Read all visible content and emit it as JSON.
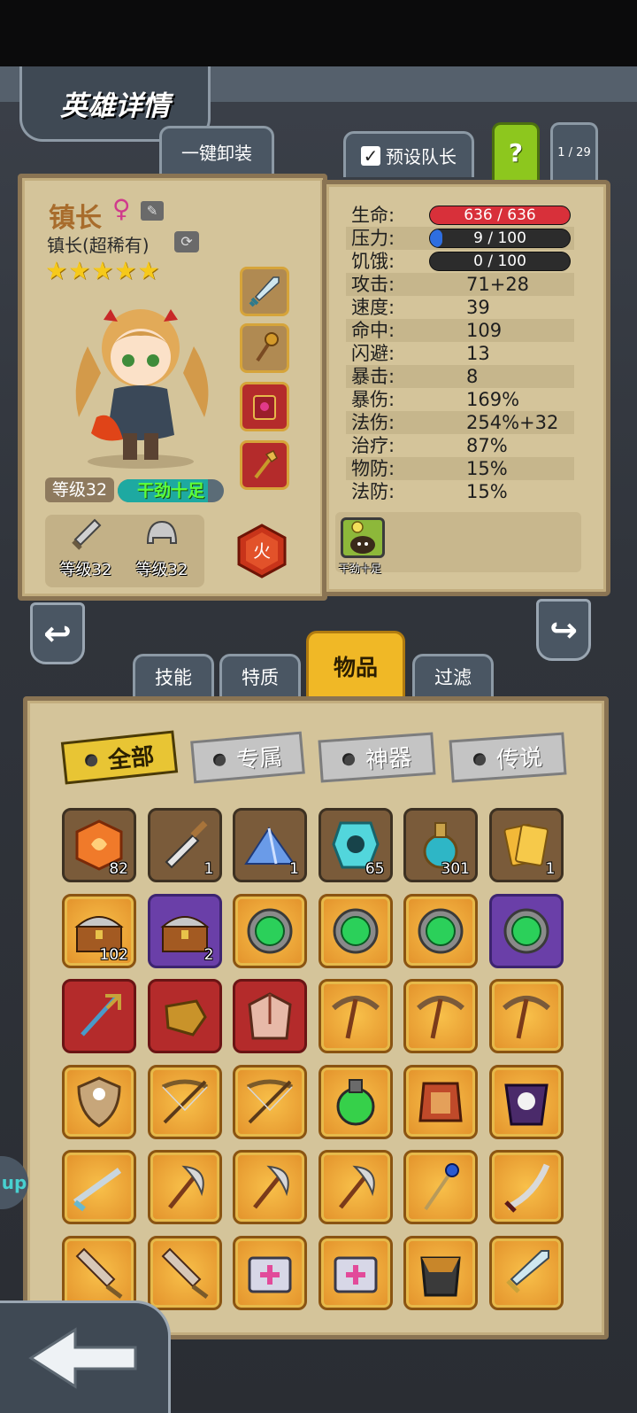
{
  "screen": {
    "title": "英雄详情",
    "unequip_all_label": "一键卸装",
    "preset_leader_label": "预设队长",
    "preset_leader_checked": true,
    "help_label": "?",
    "page_indicator": "1 / 29"
  },
  "hero": {
    "name": "镇长",
    "gender_symbol": "♀",
    "class_label": "镇长(超稀有)",
    "stars": "★★★★★",
    "star_count": 5,
    "level_label": "等级32",
    "mood_label": "干劲十足",
    "mood_fill": 0.85,
    "weapon_level": "等级32",
    "armor_level": "等级32",
    "element_label": "火",
    "equipment_slots": [
      "sword-icon",
      "staff-icon",
      "tome-icon",
      "scepter-icon"
    ]
  },
  "stats": {
    "hp": {
      "label": "生命:",
      "value": "636 / 636",
      "fill": 1.0,
      "color": "#d8303a"
    },
    "stress": {
      "label": "压力:",
      "value": "9 / 100",
      "fill": 0.09,
      "color": "#2e6ee0"
    },
    "hunger": {
      "label": "饥饿:",
      "value": "0 / 100",
      "fill": 0.0,
      "color": "#c08a2a"
    },
    "rows": [
      {
        "label": "攻击:",
        "value": "71+28"
      },
      {
        "label": "速度:",
        "value": "39"
      },
      {
        "label": "命中:",
        "value": "109"
      },
      {
        "label": "闪避:",
        "value": "13"
      },
      {
        "label": "暴击:",
        "value": "8"
      },
      {
        "label": "暴伤:",
        "value": "169%"
      },
      {
        "label": "法伤:",
        "value": "254%+32"
      },
      {
        "label": "治疗:",
        "value": "87%"
      },
      {
        "label": "物防:",
        "value": "15%"
      },
      {
        "label": "法防:",
        "value": "15%"
      }
    ],
    "trait_label": "干劲十足"
  },
  "category_tabs": [
    "技能",
    "特质",
    "物品",
    "过滤"
  ],
  "active_category": "物品",
  "filters": [
    "全部",
    "专属",
    "神器",
    "传说"
  ],
  "active_filter": "全部",
  "side_tag_label": "up",
  "inventory": [
    [
      {
        "icon": "orange-gem-icon",
        "qty": "82",
        "frame": "brown"
      },
      {
        "icon": "knife-icon",
        "qty": "1",
        "frame": "brown"
      },
      {
        "icon": "crystal-pile-icon",
        "qty": "1",
        "frame": "brown"
      },
      {
        "icon": "rune-stone-icon",
        "qty": "65",
        "frame": "brown"
      },
      {
        "icon": "potion-flask-icon",
        "qty": "301",
        "frame": "brown"
      },
      {
        "icon": "ticket-icon",
        "qty": "1",
        "frame": "brown"
      }
    ],
    [
      {
        "icon": "treasure-chest-icon",
        "qty": "102",
        "frame": "orange"
      },
      {
        "icon": "treasure-chest-icon",
        "qty": "2",
        "frame": "purple"
      },
      {
        "icon": "green-orb-icon",
        "qty": "",
        "frame": "orange"
      },
      {
        "icon": "green-orb-icon",
        "qty": "",
        "frame": "orange"
      },
      {
        "icon": "green-orb-icon",
        "qty": "",
        "frame": "orange"
      },
      {
        "icon": "green-orb-icon",
        "qty": "",
        "frame": "purple"
      }
    ],
    [
      {
        "icon": "cross-staff-icon",
        "qty": "",
        "frame": "red"
      },
      {
        "icon": "gauntlet-icon",
        "qty": "",
        "frame": "red"
      },
      {
        "icon": "cloak-icon",
        "qty": "",
        "frame": "red"
      },
      {
        "icon": "pickaxe-icon",
        "qty": "",
        "frame": "orange"
      },
      {
        "icon": "pickaxe-icon",
        "qty": "",
        "frame": "orange"
      },
      {
        "icon": "pickaxe-icon",
        "qty": "",
        "frame": "orange"
      }
    ],
    [
      {
        "icon": "shield-icon",
        "qty": "",
        "frame": "orange"
      },
      {
        "icon": "crossbow-icon",
        "qty": "",
        "frame": "orange"
      },
      {
        "icon": "crossbow-icon",
        "qty": "",
        "frame": "orange"
      },
      {
        "icon": "green-potion-icon",
        "qty": "",
        "frame": "orange"
      },
      {
        "icon": "armor-icon",
        "qty": "",
        "frame": "orange"
      },
      {
        "icon": "skull-cloak-icon",
        "qty": "",
        "frame": "orange"
      }
    ],
    [
      {
        "icon": "rifle-icon",
        "qty": "",
        "frame": "orange"
      },
      {
        "icon": "axe-icon",
        "qty": "",
        "frame": "orange"
      },
      {
        "icon": "axe-icon",
        "qty": "",
        "frame": "orange"
      },
      {
        "icon": "axe-icon",
        "qty": "",
        "frame": "orange"
      },
      {
        "icon": "wand-icon",
        "qty": "",
        "frame": "orange"
      },
      {
        "icon": "sabre-icon",
        "qty": "",
        "frame": "orange"
      }
    ],
    [
      {
        "icon": "cleaver-icon",
        "qty": "",
        "frame": "orange"
      },
      {
        "icon": "cleaver-icon",
        "qty": "",
        "frame": "orange"
      },
      {
        "icon": "medkit-icon",
        "qty": "",
        "frame": "orange"
      },
      {
        "icon": "medkit-icon",
        "qty": "",
        "frame": "orange"
      },
      {
        "icon": "chest-armor-icon",
        "qty": "",
        "frame": "orange"
      },
      {
        "icon": "sword-icon",
        "qty": "",
        "frame": "orange"
      }
    ]
  ]
}
